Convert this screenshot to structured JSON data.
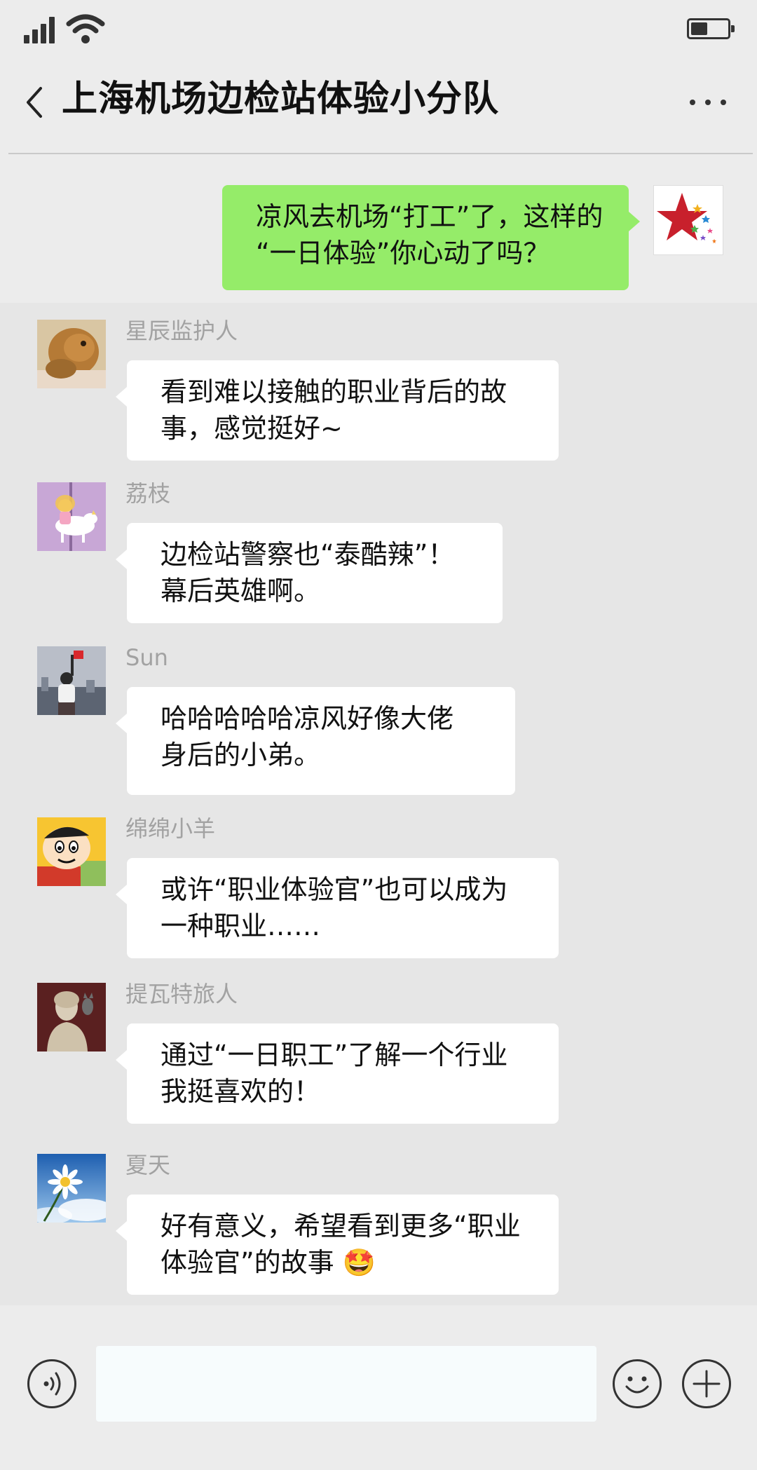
{
  "header": {
    "title": "上海机场边检站体验小分队"
  },
  "status": {
    "battery_level": 0.45
  },
  "my_message": {
    "lines": [
      "凉风去机场“打工”了，这样的",
      "“一日体验”你心动了吗？"
    ]
  },
  "messages": [
    {
      "sender": "星辰监护人",
      "lines": [
        "看到难以接触的职业背后的故",
        "事，感觉挺好~"
      ]
    },
    {
      "sender": "荔枝",
      "lines": [
        "边检站警察也“泰酷辣”！",
        "幕后英雄啊。"
      ]
    },
    {
      "sender": "Sun",
      "lines": [
        "哈哈哈哈哈凉风好像大佬",
        "身后的小弟。"
      ]
    },
    {
      "sender": "绵绵小羊",
      "lines": [
        "或许“职业体验官”也可以成为",
        "一种职业……"
      ]
    },
    {
      "sender": "提瓦特旅人",
      "lines": [
        "通过“一日职工”了解一个行业",
        "我挺喜欢的！"
      ]
    },
    {
      "sender": "夏天",
      "lines": [
        "好有意义，希望看到更多“职业",
        "体验官”的故事 🤩"
      ]
    }
  ],
  "input": {
    "value": ""
  },
  "icons": {
    "signal": "signal-icon",
    "wifi": "wifi-icon",
    "battery": "battery-icon",
    "back": "back-icon",
    "more": "more-icon",
    "voice": "voice-icon",
    "emoji": "emoji-icon",
    "plus": "plus-icon"
  },
  "colors": {
    "background": "#ececec",
    "feed_background": "#e6e6e6",
    "my_bubble": "#95ec69",
    "other_bubble": "#ffffff",
    "sender_name": "#a2a2a2"
  }
}
